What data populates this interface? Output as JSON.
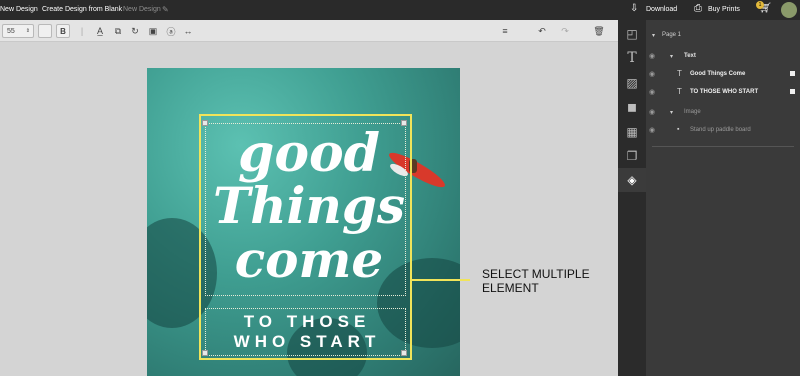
{
  "topbar": {
    "new_design": "New Design",
    "create_blank": "Create Design from Blank",
    "doc_title": "New Design",
    "download": "Download",
    "buy_prints": "Buy Prints",
    "cart_badge": "1"
  },
  "toolbar": {
    "font_size": "55",
    "bold_label": "B"
  },
  "canvas": {
    "line1": "good",
    "line2": "Things",
    "line3": "come",
    "sub1": "TO THOSE",
    "sub2": "WHO START"
  },
  "callout": {
    "line1": "SELECT MULTIPLE",
    "line2": "ELEMENT"
  },
  "layers": {
    "page": "Page 1",
    "text_group": "Text",
    "text_item1": "Good Things Come",
    "text_item2": "TO THOSE WHO START",
    "image_group": "Image",
    "image_item": "Stand up paddle board"
  },
  "colors": {
    "selection": "#f1e45a",
    "topbar": "#2a2a2a",
    "panel": "#3a3a3a"
  }
}
